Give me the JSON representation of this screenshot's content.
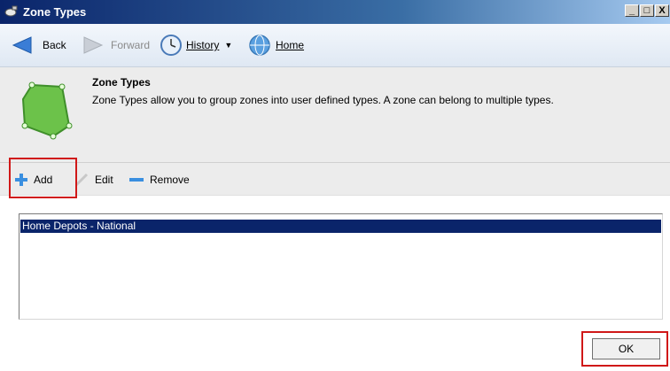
{
  "window": {
    "title": "Zone Types",
    "controls": {
      "minimize": "_",
      "maximize": "□",
      "close": "X"
    }
  },
  "nav": {
    "back_label": "Back",
    "forward_label": "Forward",
    "history_label": "History",
    "home_label": "Home"
  },
  "header": {
    "title": "Zone Types",
    "description": "Zone Types allow you to group zones into user defined types. A zone can belong to multiple types."
  },
  "toolbar": {
    "add_label": "Add",
    "edit_label": "Edit",
    "remove_label": "Remove"
  },
  "list": {
    "items": [
      "Home Depots - National"
    ],
    "selected_index": 0
  },
  "footer": {
    "ok_label": "OK"
  },
  "colors": {
    "selection": "#0a246a",
    "highlight_box": "#d01818",
    "zone_green": "#6cc24a"
  }
}
